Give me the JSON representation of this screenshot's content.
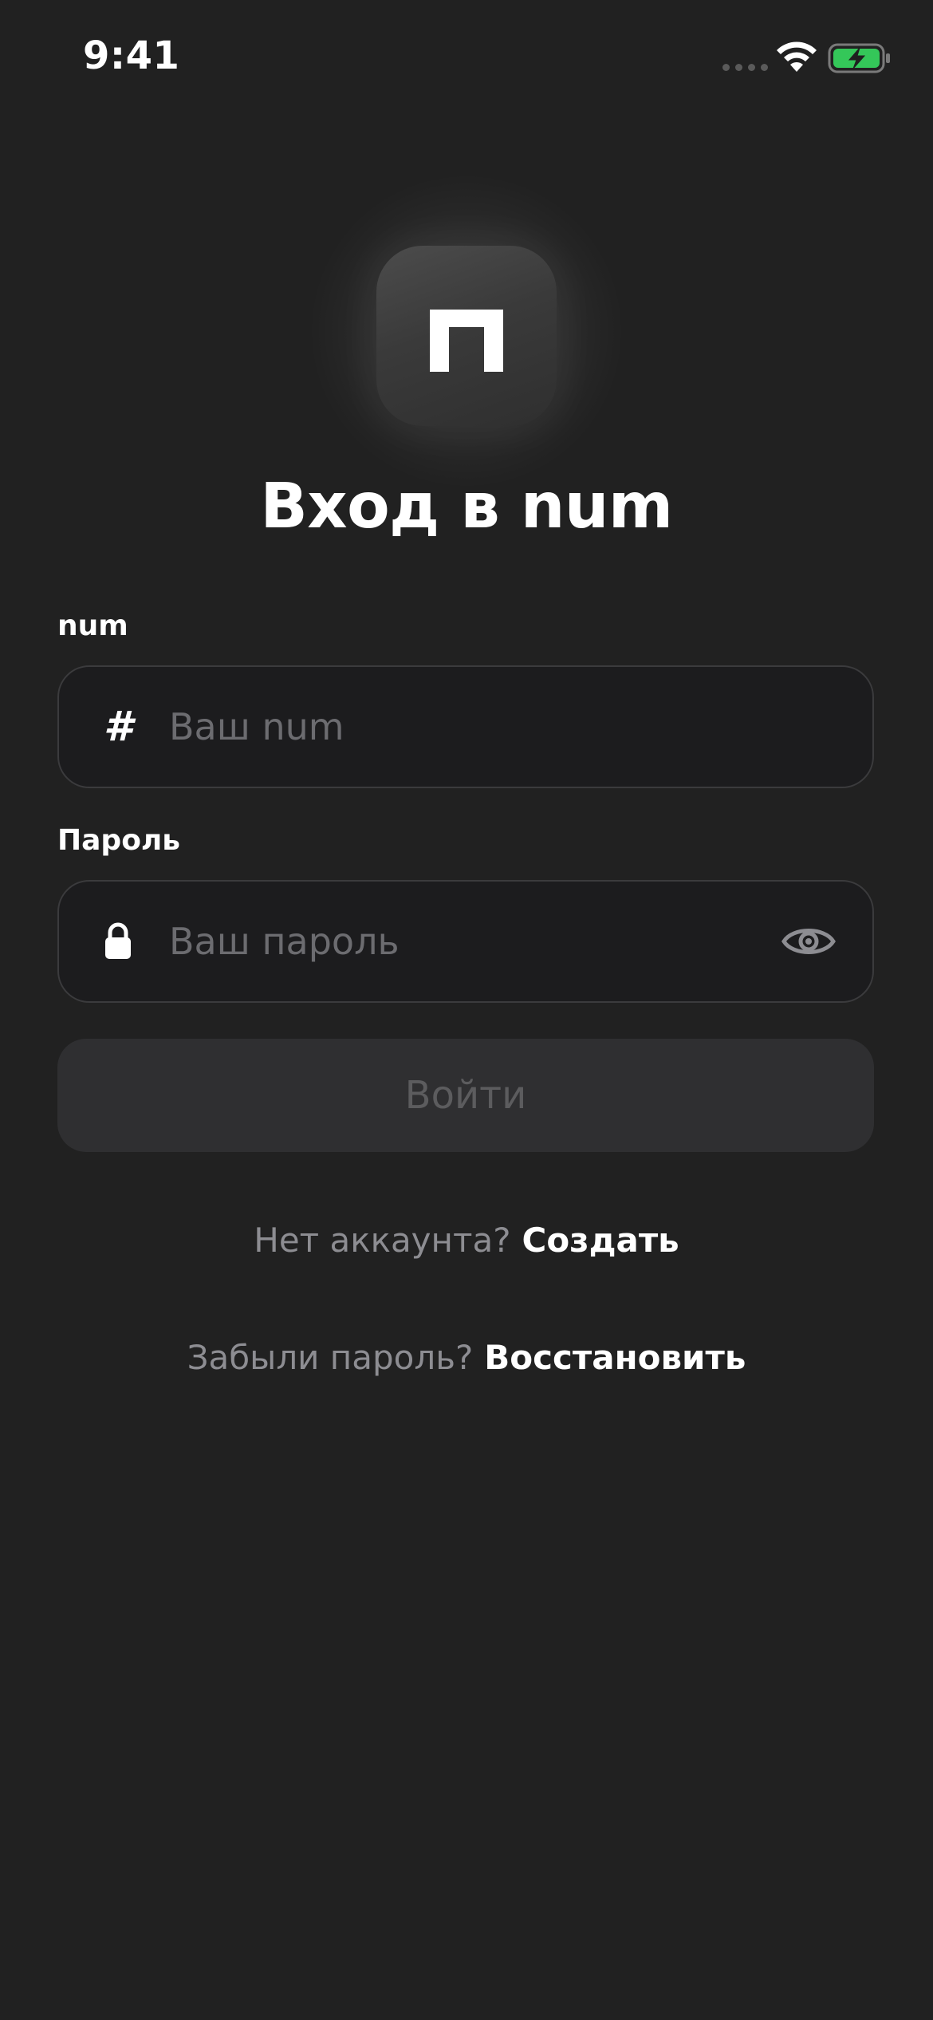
{
  "status_bar": {
    "time": "9:41",
    "battery_color": "#34c759"
  },
  "logo": {
    "icon": "num-logo-icon"
  },
  "title": "Вход в num",
  "fields": {
    "num": {
      "label": "num",
      "icon": "hash-icon",
      "icon_glyph": "#",
      "value": "",
      "placeholder": "Ваш num"
    },
    "password": {
      "label": "Пароль",
      "icon": "lock-icon",
      "value": "",
      "placeholder": "Ваш пароль",
      "toggle_icon": "eye-icon"
    }
  },
  "login_button": {
    "label": "Войти",
    "enabled": false
  },
  "links": {
    "signup": {
      "prompt": "Нет аккаунта?",
      "action": "Создать"
    },
    "recover": {
      "prompt": "Забыли пароль?",
      "action": "Восстановить"
    }
  },
  "colors": {
    "background": "#212121",
    "field_background": "#1c1c1e",
    "placeholder": "#6c6c70",
    "button_disabled_bg": "#2f2f31",
    "button_disabled_text": "#5c5c5e",
    "muted_text": "#8d8d92"
  }
}
